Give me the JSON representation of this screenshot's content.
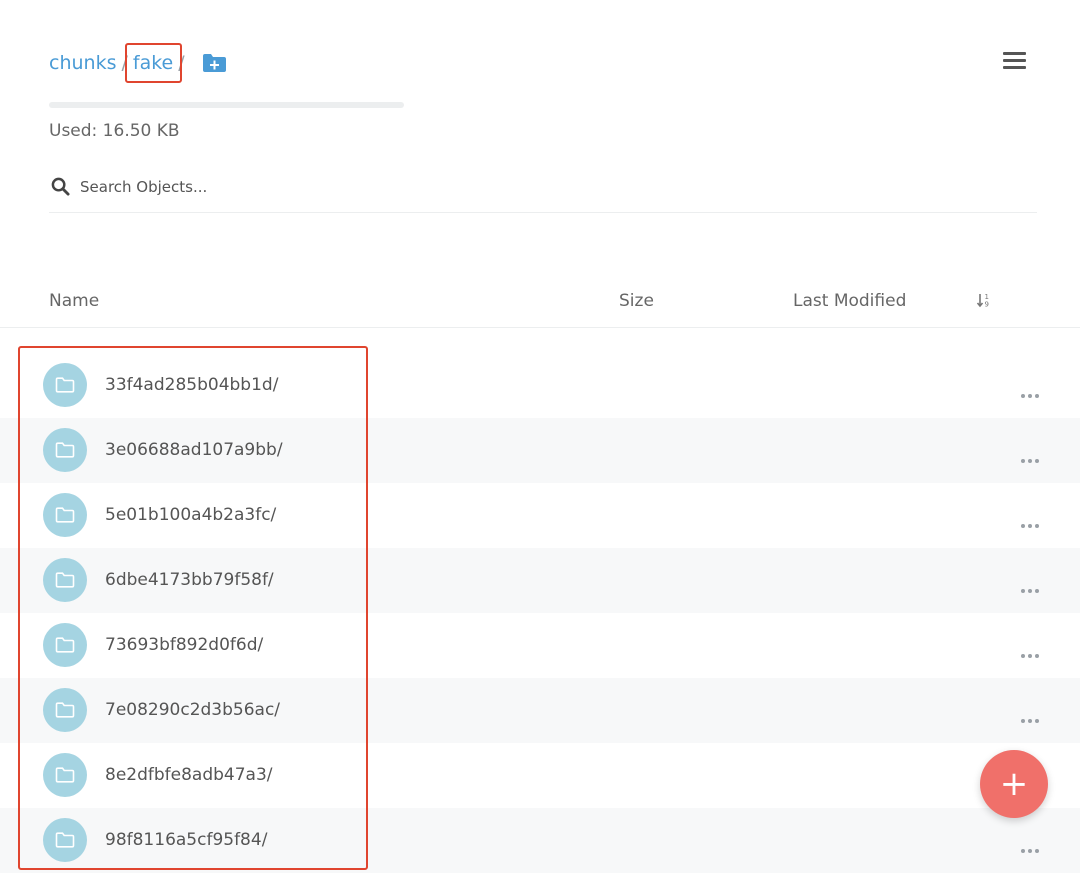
{
  "breadcrumb": {
    "root": "chunks",
    "current": "fake",
    "separator": "/"
  },
  "usage": {
    "label": "Used: 16.50 KB",
    "fill_percent": 0
  },
  "search": {
    "placeholder": "Search Objects..."
  },
  "table": {
    "col_name": "Name",
    "col_size": "Size",
    "col_modified": "Last Modified"
  },
  "rows": [
    {
      "name": "33f4ad285b04bb1d/"
    },
    {
      "name": "3e06688ad107a9bb/"
    },
    {
      "name": "5e01b100a4b2a3fc/"
    },
    {
      "name": "6dbe4173bb79f58f/"
    },
    {
      "name": "73693bf892d0f6d/"
    },
    {
      "name": "7e08290c2d3b56ac/"
    },
    {
      "name": "8e2dfbfe8adb47a3/"
    },
    {
      "name": "98f8116a5cf95f84/"
    }
  ],
  "fab": {
    "label": "+"
  },
  "colors": {
    "accent": "#4a9bd6",
    "folder_avatar": "#a5d4e2",
    "fab": "#f0706a",
    "highlight": "#e0452f"
  }
}
